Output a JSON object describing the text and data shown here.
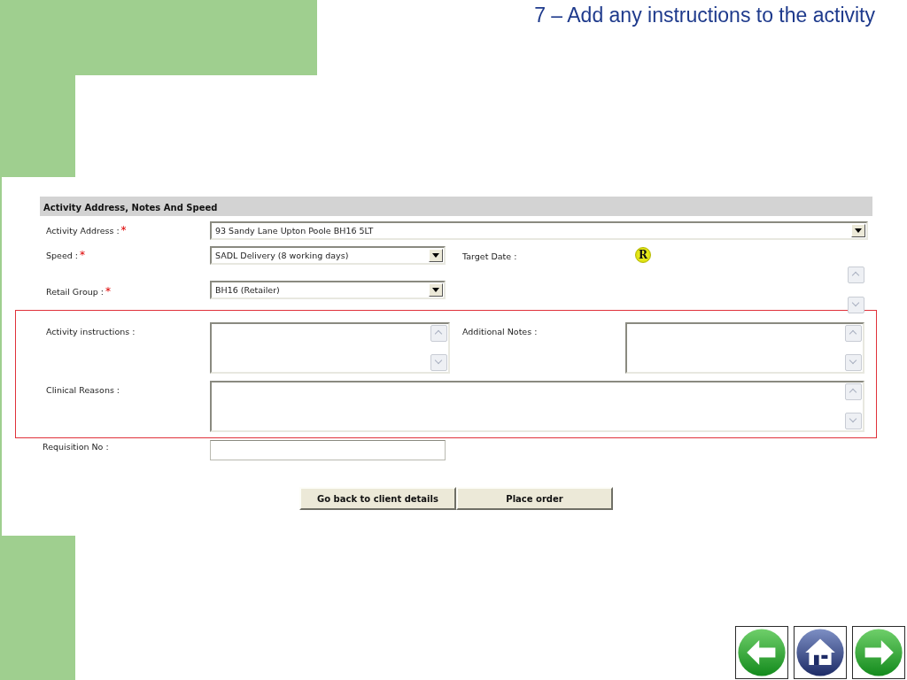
{
  "title": "7 – Add any instructions to the activity",
  "form": {
    "heading": "Activity Address, Notes And Speed",
    "activity_address": {
      "label": "Activity Address :",
      "required_mark": "*",
      "value": "93 Sandy Lane Upton Poole BH16 5LT"
    },
    "speed": {
      "label": "Speed :",
      "required_mark": "*",
      "value": "SADL Delivery (8 working days)"
    },
    "target_date": {
      "label": "Target Date :",
      "badge": "R"
    },
    "retail_group": {
      "label": "Retail Group :",
      "required_mark": "*",
      "value": "BH16 (Retailer)"
    },
    "highlighted_fields": {
      "activity_instructions": {
        "label": "Activity instructions :"
      },
      "additional_notes": {
        "label": "Additional Notes :"
      },
      "clinical_reasons": {
        "label": "Clinical Reasons :"
      }
    },
    "requisition_no": {
      "label": "Requisition No :"
    },
    "buttons": [
      "Go back to client details",
      "Place order"
    ]
  }
}
